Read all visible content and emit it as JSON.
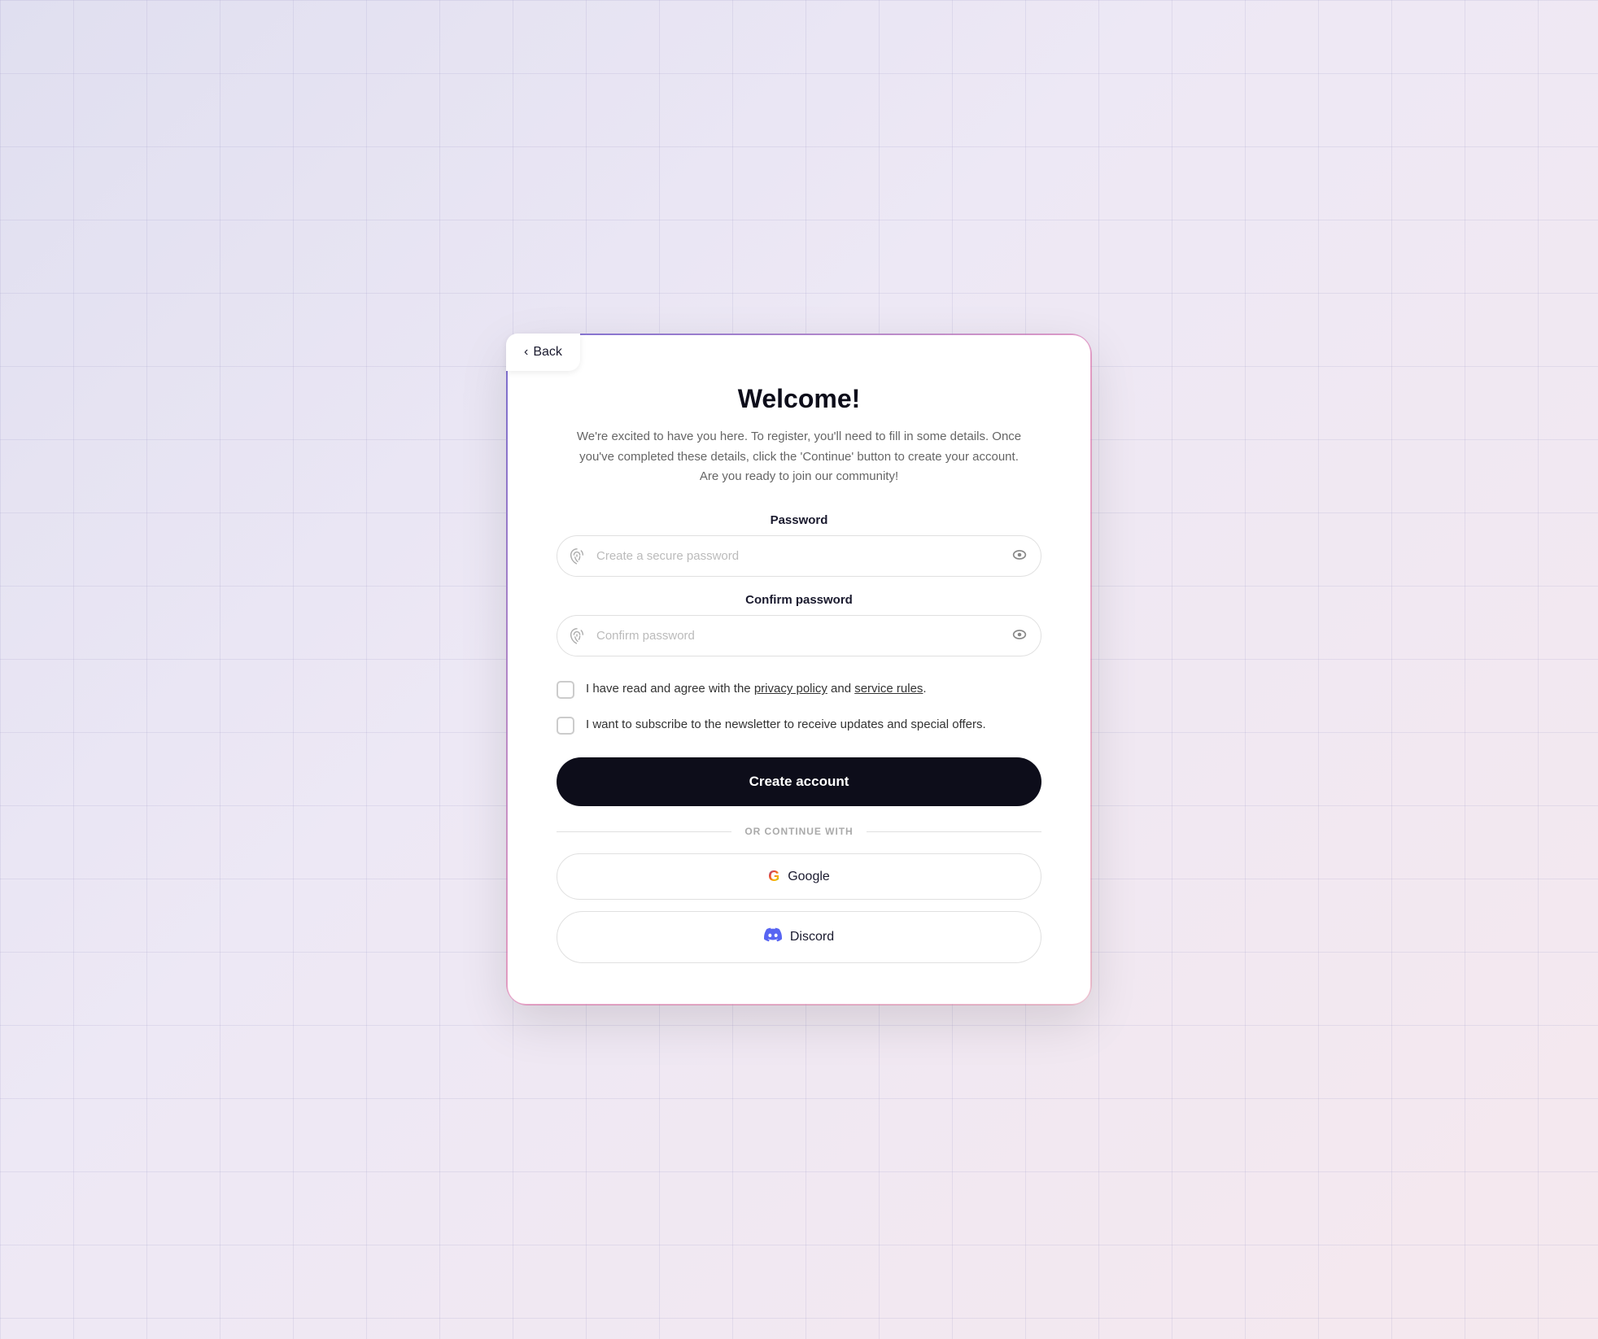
{
  "back": {
    "label": "Back"
  },
  "header": {
    "title": "Welcome!",
    "subtitle": "We're excited to have you here. To register, you'll need to fill in some details. Once you've completed these details, click the 'Continue' button to create your account. Are you ready to join our community!"
  },
  "password_field": {
    "label": "Password",
    "placeholder": "Create a secure password"
  },
  "confirm_field": {
    "label": "Confirm password",
    "placeholder": "Confirm password"
  },
  "checkboxes": {
    "privacy": {
      "text_before": "I have read and agree with the ",
      "link1": "privacy policy",
      "text_middle": " and ",
      "link2": "service rules",
      "text_after": "."
    },
    "newsletter": {
      "text": "I want to subscribe to the newsletter to receive updates and special offers."
    }
  },
  "create_btn": "Create account",
  "divider": "OR CONTINUE WITH",
  "social": {
    "google": "Google",
    "discord": "Discord"
  }
}
